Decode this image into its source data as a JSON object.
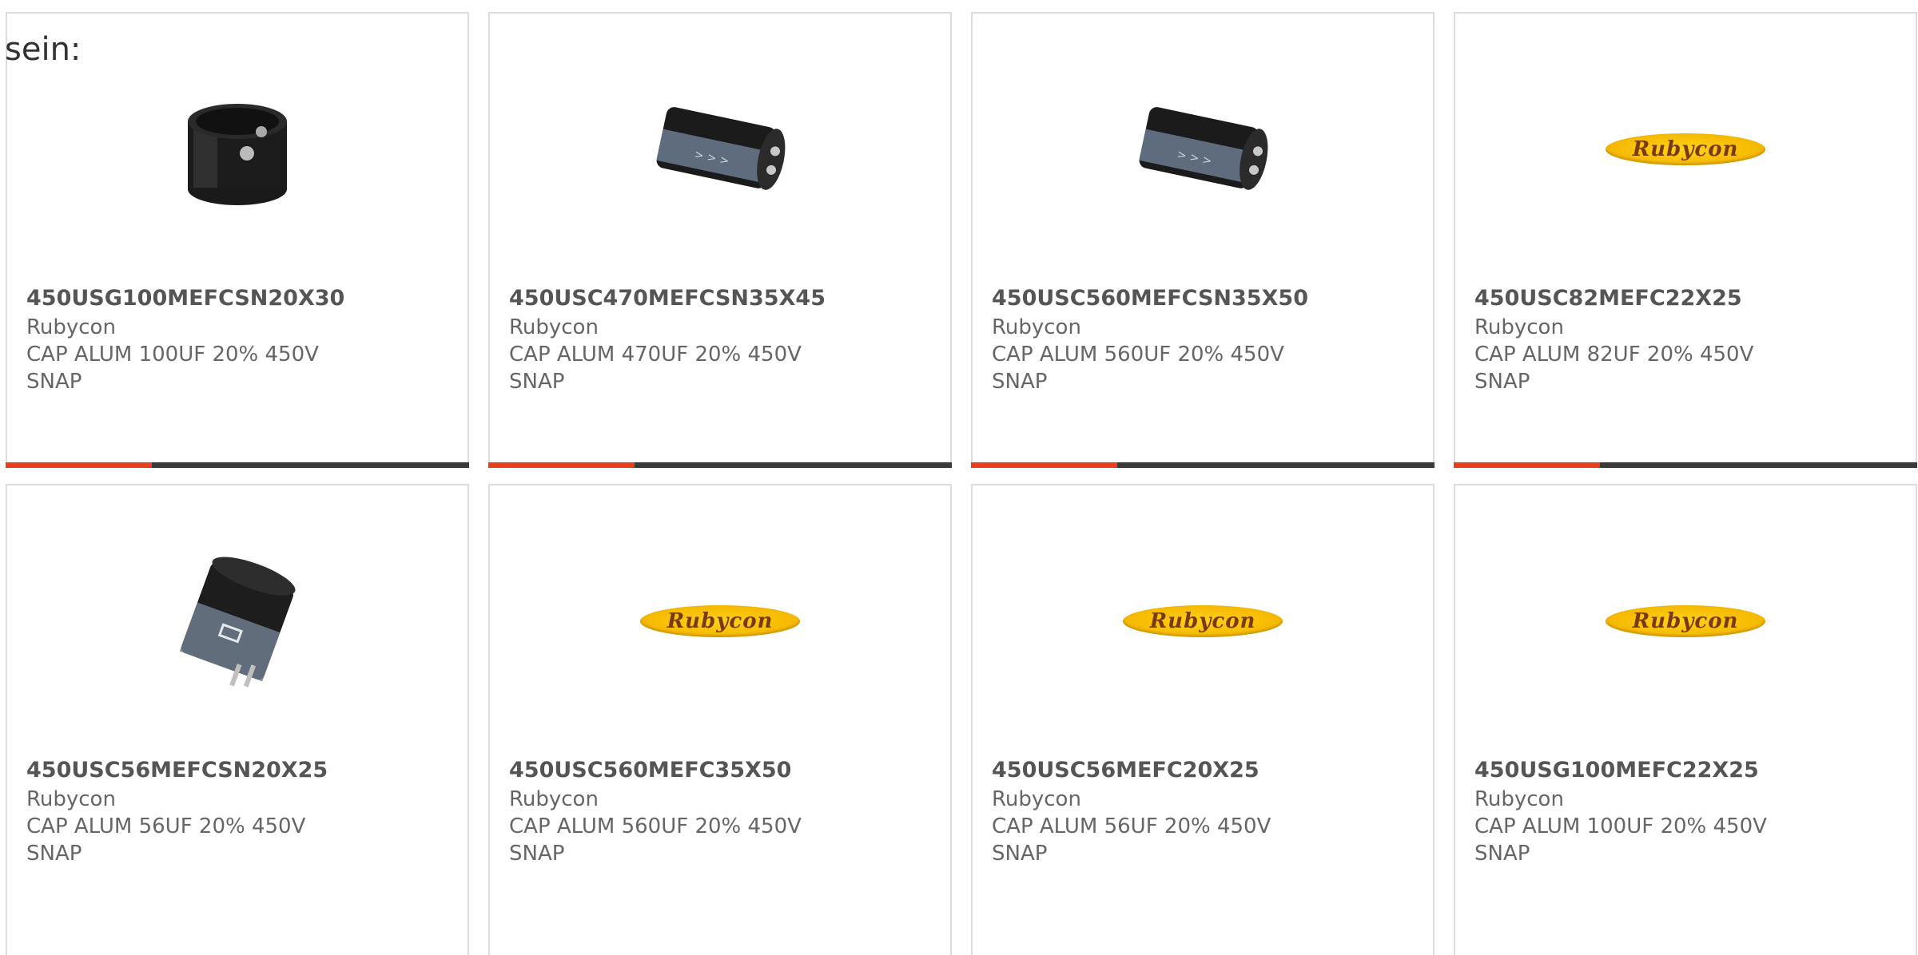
{
  "intro_text": "sein:",
  "colors": {
    "accent_bar": "#e8401c",
    "bar": "#3a3a3a",
    "border": "#dcdcdc",
    "text": "#666666"
  },
  "products": [
    {
      "part": "450USG100MEFCSN20X30",
      "manufacturer": "Rubycon",
      "description": "CAP ALUM 100UF 20% 450V SNAP",
      "image": "capacitor-short-icon"
    },
    {
      "part": "450USC470MEFCSN35X45",
      "manufacturer": "Rubycon",
      "description": "CAP ALUM 470UF 20% 450V SNAP",
      "image": "capacitor-long-icon"
    },
    {
      "part": "450USC560MEFCSN35X50",
      "manufacturer": "Rubycon",
      "description": "CAP ALUM 560UF 20% 450V SNAP",
      "image": "capacitor-long-icon"
    },
    {
      "part": "450USC82MEFC22X25",
      "manufacturer": "Rubycon",
      "description": "CAP ALUM 82UF 20% 450V SNAP",
      "image": "rubycon-logo",
      "logo_text": "Rubycon"
    },
    {
      "part": "450USC56MEFCSN20X25",
      "manufacturer": "Rubycon",
      "description": "CAP ALUM 56UF 20% 450V SNAP",
      "image": "capacitor-angled-icon"
    },
    {
      "part": "450USC560MEFC35X50",
      "manufacturer": "Rubycon",
      "description": "CAP ALUM 560UF 20% 450V SNAP",
      "image": "rubycon-logo",
      "logo_text": "Rubycon"
    },
    {
      "part": "450USC56MEFC20X25",
      "manufacturer": "Rubycon",
      "description": "CAP ALUM 56UF 20% 450V SNAP",
      "image": "rubycon-logo",
      "logo_text": "Rubycon"
    },
    {
      "part": "450USG100MEFC22X25",
      "manufacturer": "Rubycon",
      "description": "CAP ALUM 100UF 20% 450V SNAP",
      "image": "rubycon-logo",
      "logo_text": "Rubycon"
    }
  ]
}
